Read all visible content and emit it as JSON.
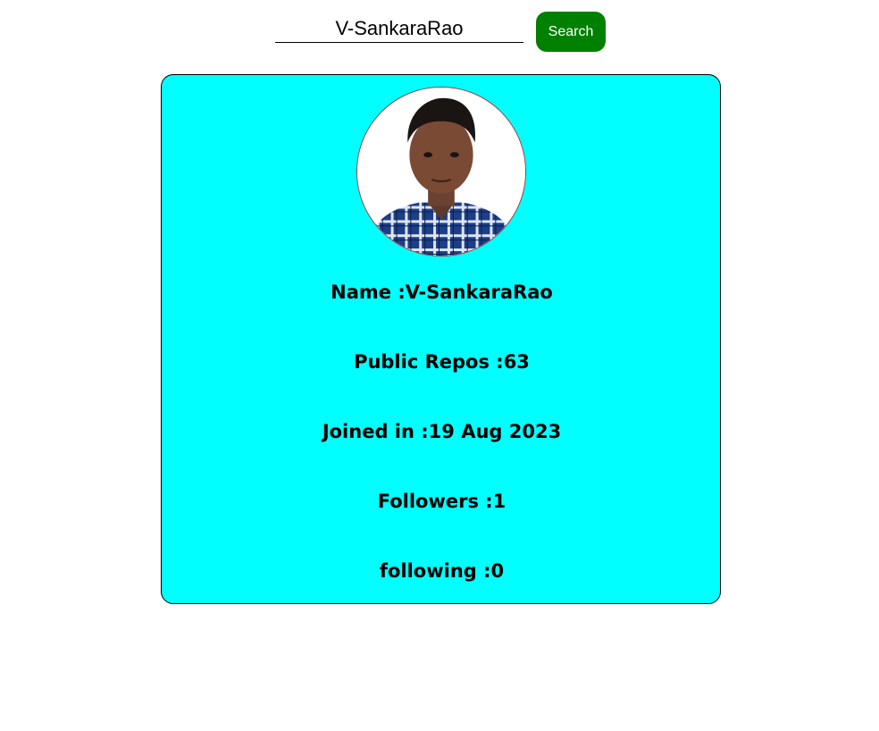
{
  "colors": {
    "card_background": "#00ffff",
    "search_button": "#008000",
    "avatar_border": "#b03030"
  },
  "search": {
    "value": "V-SankaraRao",
    "button_label": "Search"
  },
  "profile": {
    "avatar_icon": "profile-photo",
    "fields": [
      {
        "label": "Name :",
        "value": "V-SankaraRao"
      },
      {
        "label": "Public Repos :",
        "value": "63"
      },
      {
        "label": "Joined in :",
        "value": "19 Aug 2023"
      },
      {
        "label": "Followers :",
        "value": "1"
      },
      {
        "label": "following :",
        "value": "0"
      }
    ]
  }
}
